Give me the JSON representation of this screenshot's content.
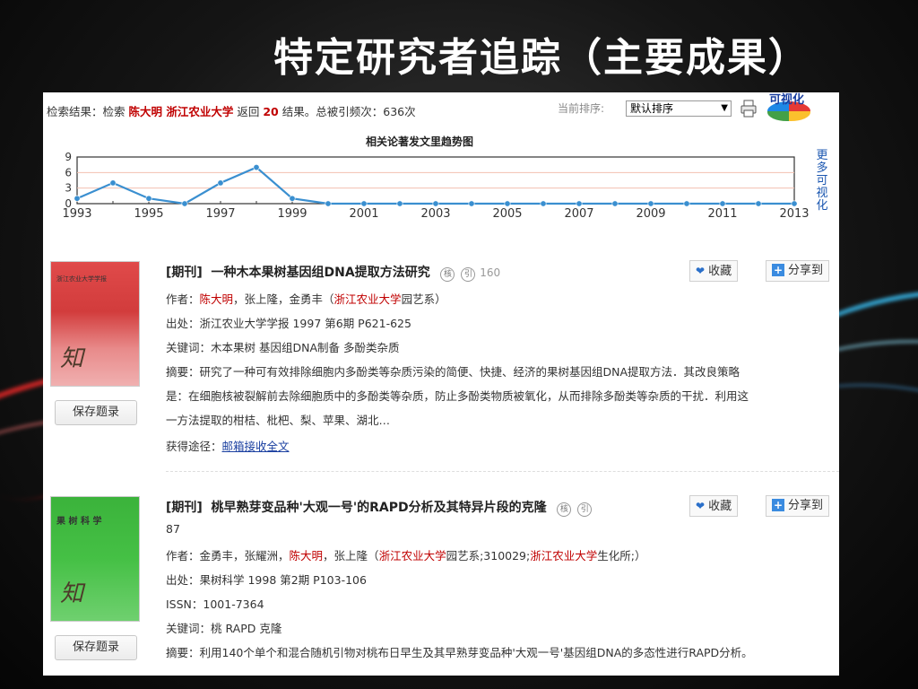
{
  "slide_title": "特定研究者追踪（主要成果）",
  "summary": {
    "prefix": "检索结果：检索",
    "query": "陈大明 浙江农业大学",
    "mid": "返回",
    "count": "20",
    "suffix": "结果。总被引频次：636次"
  },
  "sort": {
    "label": "当前排序:",
    "selected": "默认排序"
  },
  "viz_label": "可视化",
  "more_viz": "更多可视化",
  "chart_data": {
    "type": "line",
    "title": "相关论著发文里趋势图",
    "x": [
      1993,
      1994,
      1995,
      1996,
      1997,
      1998,
      1999,
      2000,
      2001,
      2002,
      2003,
      2004,
      2005,
      2006,
      2007,
      2008,
      2009,
      2010,
      2011,
      2012,
      2013
    ],
    "values": [
      1,
      4,
      1,
      0,
      4,
      7,
      1,
      0,
      0,
      0,
      0,
      0,
      0,
      0,
      0,
      0,
      0,
      0,
      0,
      0,
      0
    ],
    "x_tick_labels": [
      "1993",
      "1995",
      "1997",
      "1999",
      "2001",
      "2003",
      "2005",
      "2007",
      "2009",
      "2011",
      "2013"
    ],
    "y_tick_labels": [
      "9",
      "6",
      "3",
      "0"
    ],
    "ylim": [
      0,
      9
    ],
    "grid": true
  },
  "records": [
    {
      "thumb_header": "浙江农业大学学报",
      "thumb_sig": "知",
      "save_label": "保存题录",
      "type": "[期刊]",
      "title": "一种木本果树基因组DNA提取方法研究",
      "badge_core": "核",
      "badge_cite": "引",
      "cite_count": "160",
      "fav_label": "收藏",
      "share_label": "分享到",
      "author_label": "作者：",
      "author_highlight": "陈大明",
      "author_rest": "，张上隆，金勇丰（",
      "org_highlight": "浙江农业大学",
      "org_rest": "园艺系）",
      "source": "出处：浙江农业大学学报 1997 第6期 P621-625",
      "keywords": "关键词：木本果树  基因组DNA制备  多酚类杂质",
      "abstract_1": "摘要：研究了一种可有效排除细胞内多酚类等杂质污染的简便、快捷、经济的果树基因组DNA提取方法．其改良策略",
      "abstract_2": "是：在细胞核被裂解前去除细胞质中的多酚类等杂质，防止多酚类物质被氧化，从而排除多酚类等杂质的干扰．利用这",
      "abstract_3": "一方法提取的柑桔、枇杷、梨、苹果、湖北…",
      "access_label": "获得途径：",
      "access_link": "邮箱接收全文"
    },
    {
      "thumb_header": "果 树 科 学",
      "thumb_sig": "知",
      "save_label": "保存题录",
      "type": "[期刊]",
      "title": "桃早熟芽变品种'大观一号'的RAPD分析及其特异片段的克隆",
      "badge_core": "核",
      "badge_cite": "引",
      "cite_count": "87",
      "fav_label": "收藏",
      "share_label": "分享到",
      "author_label": "作者：",
      "author_pre": "金勇丰，张耀洲，",
      "author_highlight": "陈大明",
      "author_rest": "，张上隆（",
      "org_highlight": "浙江农业大学",
      "org_mid": "园艺系;310029;",
      "org_highlight_2": "浙江农业大学",
      "org_rest": "生化所;）",
      "source": "出处：果树科学 1998 第2期 P103-106",
      "issn": "ISSN：1001-7364",
      "keywords": "关键词：桃  RAPD  克隆",
      "abstract_1": "摘要：利用140个单个和混合随机引物对桃布日早生及其早熟芽变品种'大观一号'基因组DNA的多态性进行RAPD分析。"
    }
  ]
}
